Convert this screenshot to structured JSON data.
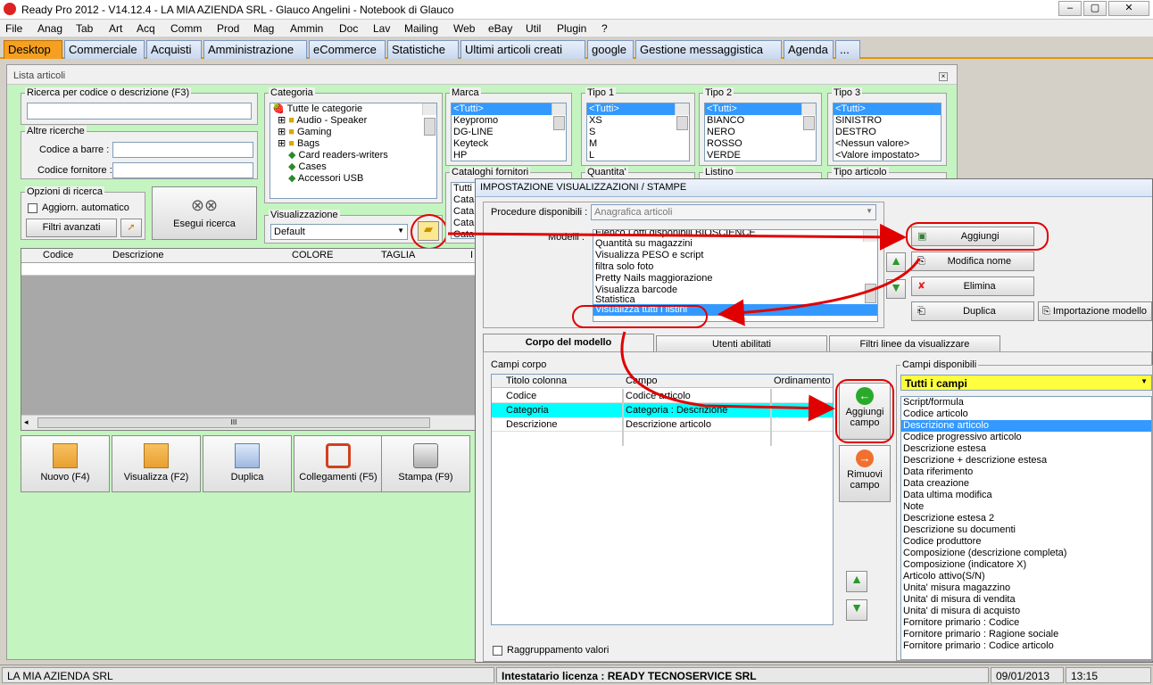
{
  "window": {
    "title": "Ready Pro 2012 - V14.12.4 - LA MIA AZIENDA SRL - Glauco Angelini - Notebook di Glauco"
  },
  "menu": [
    "File",
    "Anag",
    "Tab",
    "Art",
    "Acq",
    "Comm",
    "Prod",
    "Mag",
    "Ammin",
    "Doc",
    "Lav",
    "Mailing",
    "Web",
    "eBay",
    "Util",
    "Plugin",
    "?"
  ],
  "tabs": [
    "Desktop",
    "Commerciale",
    "Acquisti",
    "Amministrazione",
    "eCommerce",
    "Statistiche",
    "Ultimi articoli creati",
    "google",
    "Gestione messaggistica",
    "Agenda",
    "..."
  ],
  "lista": {
    "title": "Lista articoli",
    "search_label": "Ricerca per codice o descrizione (F3)",
    "altre_label": "Altre ricerche",
    "barcode_label": "Codice a barre :",
    "fornitore_label": "Codice fornitore :",
    "opzioni_label": "Opzioni di ricerca",
    "auto_label": "Aggiorn. automatico",
    "filtri_label": "Filtri avanzati",
    "esegui_label": "Esegui ricerca",
    "categoria_label": "Categoria",
    "categorie": [
      "Tutte le categorie",
      "Audio - Speaker",
      "Gaming",
      "Bags",
      "Card readers-writers",
      "Cases",
      "Accessori USB"
    ],
    "visual_label": "Visualizzazione",
    "visual_value": "Default",
    "marca_label": "Marca",
    "marca": [
      "<Tutti>",
      "Keypromo",
      "DG-LINE",
      "Keyteck",
      "HP"
    ],
    "tipo1_label": "Tipo 1",
    "tipo1": [
      "<Tutti>",
      "XS",
      "S",
      "M",
      "L"
    ],
    "tipo2_label": "Tipo 2",
    "tipo2": [
      "<Tutti>",
      "BIANCO",
      "NERO",
      "ROSSO",
      "VERDE"
    ],
    "tipo3_label": "Tipo 3",
    "tipo3": [
      "<Tutti>",
      "SINISTRO",
      "DESTRO",
      "<Nessun valore>",
      "<Valore impostato>"
    ],
    "cataloghi_label": "Cataloghi fornitori",
    "cataloghi": [
      "Tutti",
      "Cata",
      "Cata",
      "Cata",
      "Cata"
    ],
    "quantita_label": "Quantita'",
    "listino_label": "Listino",
    "tipoart_label": "Tipo articolo",
    "grid_cols": [
      "Codice",
      "Descrizione",
      "COLORE",
      "TAGLIA",
      "I"
    ],
    "scroll_mark": "III",
    "buttons": [
      "Nuovo (F4)",
      "Visualizza (F2)",
      "Duplica",
      "Collegamenti (F5)",
      "Stampa (F9)"
    ]
  },
  "dialog": {
    "title": "IMPOSTAZIONE VISUALIZZAZIONI / STAMPE",
    "procedure_label": "Procedure disponibili :",
    "procedure_value": "Anagrafica articoli",
    "modelli_label": "Modelli :",
    "modelli": [
      "Elenco Lotti disponibili BIOSCIENCE",
      "Quantità su magazzini",
      "Visualizza PESO e script",
      "filtra solo foto",
      "Pretty Nails maggiorazione",
      "Visualizza barcode",
      "Statistica",
      "Visualizza tutti i listini"
    ],
    "btn_aggiungi": "Aggiungi",
    "btn_modifica": "Modifica nome",
    "btn_elimina": "Elimina",
    "btn_duplica": "Duplica",
    "btn_importa": "Importazione modello",
    "tabs": [
      "Corpo del modello",
      "Utenti abilitati",
      "Filtri linee da visualizzare"
    ],
    "campi_corpo_label": "Campi corpo",
    "corpo_cols": [
      "Titolo colonna",
      "Campo",
      "Ordinamento"
    ],
    "corpo_rows": [
      {
        "titolo": "Codice",
        "campo": "Codice articolo"
      },
      {
        "titolo": "Categoria",
        "campo": "Categoria : Descrizione"
      },
      {
        "titolo": "Descrizione",
        "campo": "Descrizione articolo"
      }
    ],
    "aggiungi_campo": "Aggiungi campo",
    "rimuovi_campo": "Rimuovi campo",
    "raggruppamento": "Raggruppamento valori",
    "campi_disp_label": "Campi disponibili",
    "campi_disp_filter": "Tutti i campi",
    "campi_disp": [
      "Script/formula",
      "Codice articolo",
      "Descrizione articolo",
      "Codice progressivo articolo",
      "Descrizione estesa",
      "Descrizione + descrizione estesa",
      "Data riferimento",
      "Data creazione",
      "Data ultima modifica",
      "Note",
      "Descrizione estesa 2",
      "Descrizione su documenti",
      "Codice produttore",
      "Composizione (descrizione completa)",
      "Composizione (indicatore X)",
      "Articolo attivo(S/N)",
      "Unita' misura magazzino",
      "Unita' di misura di vendita",
      "Unita' di misura di acquisto",
      "Fornitore primario : Codice",
      "Fornitore primario : Ragione sociale",
      "Fornitore primario : Codice articolo"
    ]
  },
  "status": {
    "company": "LA MIA AZIENDA SRL",
    "license_label": "Intestatario licenza :",
    "license_value": "READY TECNOSERVICE SRL",
    "date": "09/01/2013",
    "time": "13:15"
  },
  "colors": {
    "tab_active": "#f5a020",
    "panel_bg": "#c4f4c0",
    "highlight": "#e00000",
    "selection": "#3399ff",
    "row_cyan": "#00ffff",
    "filter_yellow": "#ffff40"
  }
}
